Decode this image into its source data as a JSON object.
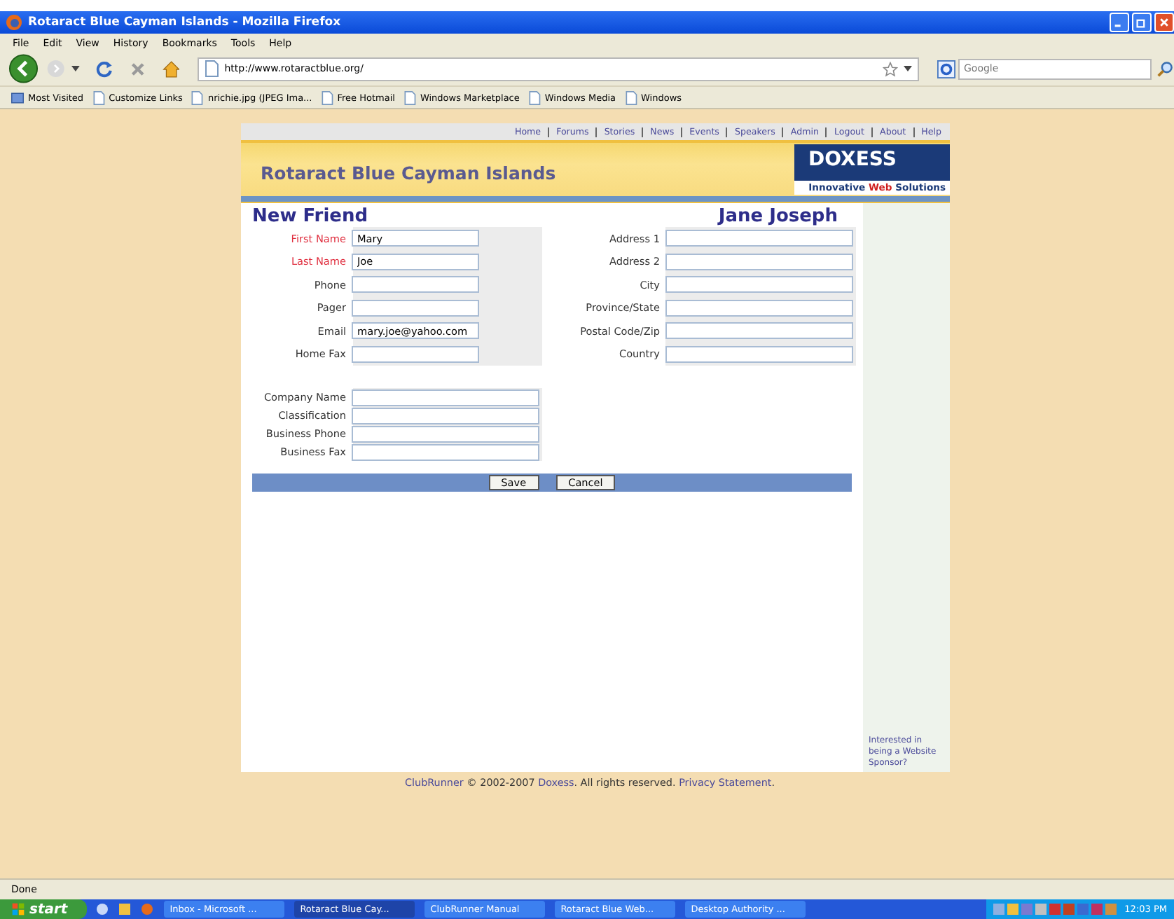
{
  "window": {
    "title": "Rotaract Blue Cayman Islands - Mozilla Firefox"
  },
  "menu": [
    "File",
    "Edit",
    "View",
    "History",
    "Bookmarks",
    "Tools",
    "Help"
  ],
  "address_bar": {
    "value": "http://www.rotaractblue.org/"
  },
  "search": {
    "placeholder": "Google"
  },
  "bookmarks": [
    "Most Visited",
    "Customize Links",
    "nrichie.jpg (JPEG Ima...",
    "Free Hotmail",
    "Windows Marketplace",
    "Windows Media",
    "Windows"
  ],
  "site": {
    "nav": [
      "Home",
      "Forums",
      "Stories",
      "News",
      "Events",
      "Speakers",
      "Admin",
      "Logout",
      "About",
      "Help"
    ],
    "title": "Rotaract Blue Cayman Islands",
    "logo": {
      "name": "DOXESS",
      "tagline": [
        {
          "text": "Innovative ",
          "accent": false
        },
        {
          "text": "Web",
          "accent": true
        },
        {
          "text": " Solutions",
          "accent": false
        }
      ]
    },
    "heading": "New Friend",
    "member": "Jane Joseph",
    "personal_fields": [
      {
        "label": "First Name",
        "value": "Mary",
        "required": true
      },
      {
        "label": "Last Name",
        "value": "Joe",
        "required": true
      },
      {
        "label": "Phone",
        "required": false
      },
      {
        "label": "Pager",
        "required": false
      },
      {
        "label": "Email",
        "value": "mary.joe@yahoo.com",
        "required": false
      },
      {
        "label": "Home Fax",
        "required": false
      }
    ],
    "address_fields": [
      {
        "label": "Address 1"
      },
      {
        "label": "Address 2"
      },
      {
        "label": "City"
      },
      {
        "label": "Province/State"
      },
      {
        "label": "Postal Code/Zip"
      },
      {
        "label": "Country"
      }
    ],
    "business_fields": [
      {
        "label": "Company Name"
      },
      {
        "label": "Classification"
      },
      {
        "label": "Business Phone"
      },
      {
        "label": "Business Fax"
      }
    ],
    "buttons": [
      "Save",
      "Cancel"
    ],
    "sidebar_text": "Interested in being a Website Sponsor?",
    "footer": [
      {
        "text": "ClubRunner",
        "link": true
      },
      {
        "text": " © 2002-2007 ",
        "link": false
      },
      {
        "text": "Doxess",
        "link": true
      },
      {
        "text": ". All rights reserved. ",
        "link": false
      },
      {
        "text": "Privacy Statement",
        "link": true
      },
      {
        "text": ".",
        "link": false
      }
    ]
  },
  "status_bar": {
    "text": "Done"
  },
  "taskbar": {
    "start": "start",
    "tasks": [
      {
        "label": "Inbox - Microsoft ...",
        "selected": false
      },
      {
        "label": "Rotaract Blue Cay...",
        "selected": true
      },
      {
        "label": "ClubRunner Manual",
        "selected": false
      },
      {
        "label": "Rotaract Blue Web...",
        "selected": false
      },
      {
        "label": "Desktop Authority ...",
        "selected": false
      }
    ],
    "clock": "12:03 PM"
  }
}
